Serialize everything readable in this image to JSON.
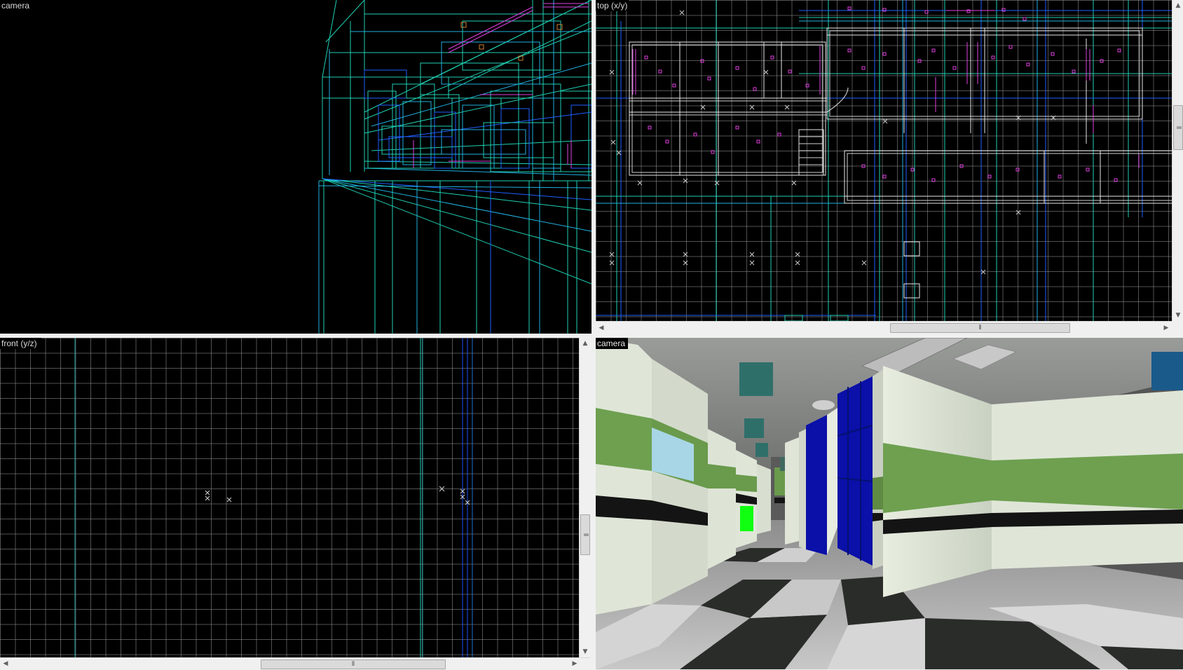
{
  "viewports": {
    "camera_wireframe": {
      "label": "camera"
    },
    "top": {
      "label": "top (x/y)"
    },
    "front": {
      "label": "front (y/z)"
    },
    "camera_textured": {
      "label": "camera"
    }
  },
  "scrollbars": {
    "up_arrow": "▲",
    "down_arrow": "▼",
    "left_arrow": "◀",
    "right_arrow": "▶",
    "grip": "⦀"
  },
  "colors": {
    "viewport_bg": "#000000",
    "grid_line": "#969696",
    "brush_wire": "#1fd1b4",
    "brush_blue": "#2060ff",
    "entity_magenta": "#e040e0",
    "wall_white": "#dfe6d8",
    "wall_green": "#6ea050",
    "locker_blue": "#0a10a8",
    "exit_green": "#10ff10"
  }
}
